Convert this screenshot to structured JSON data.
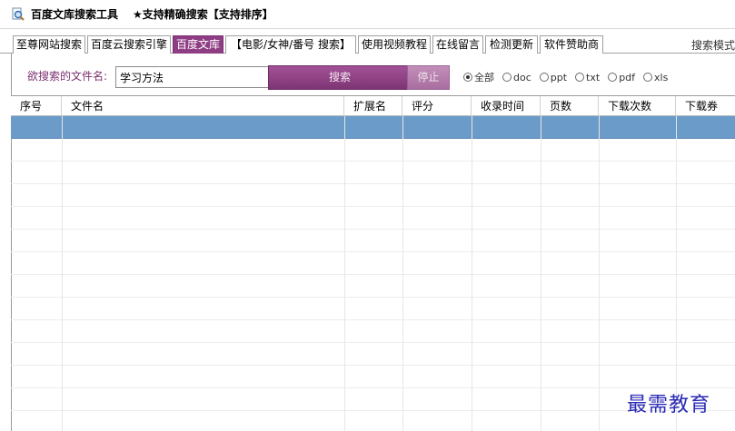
{
  "window": {
    "title": "百度文库搜索工具",
    "subtitle": "★支持精确搜索【支持排序】",
    "icon": "search-magnifier-icon"
  },
  "tabs": [
    {
      "label": "至尊网站搜索",
      "active": false
    },
    {
      "label": "百度云搜索引擎",
      "active": false
    },
    {
      "label": "百度文库",
      "active": true
    },
    {
      "label": "【电影/女神/番号  搜索】",
      "active": false
    },
    {
      "label": "使用视频教程",
      "active": false
    },
    {
      "label": "在线留言",
      "active": false
    },
    {
      "label": "检测更新",
      "active": false
    },
    {
      "label": "软件赞助商",
      "active": false
    }
  ],
  "tab_overflow": "搜索模式",
  "search": {
    "label": "欲搜索的文件名:",
    "value": "学习方法",
    "search_button": "搜索",
    "stop_button": "停止"
  },
  "filters": [
    {
      "label": "全部",
      "selected": true
    },
    {
      "label": "doc",
      "selected": false
    },
    {
      "label": "ppt",
      "selected": false
    },
    {
      "label": "txt",
      "selected": false
    },
    {
      "label": "pdf",
      "selected": false
    },
    {
      "label": "xls",
      "selected": false
    }
  ],
  "table": {
    "columns": [
      "序号",
      "文件名",
      "扩展名",
      "评分",
      "收录时间",
      "页数",
      "下载次数",
      "下载券"
    ],
    "rows": []
  },
  "watermark": "最需教育",
  "colors": {
    "accent": "#8f3d84",
    "selected_row": "#6b9bc8",
    "watermark": "#2b2bb5"
  }
}
